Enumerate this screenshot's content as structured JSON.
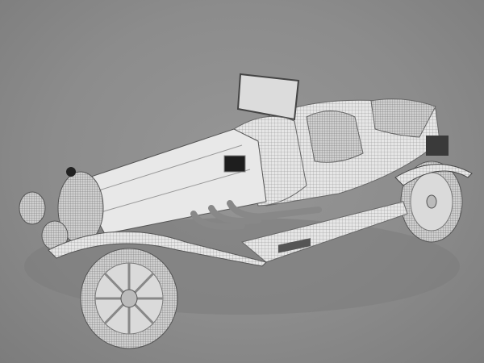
{
  "scene": {
    "subject": "wireframe-vintage-car-render",
    "colors": {
      "background": "#8c8c8c",
      "body": "#e4e4e4",
      "wire": "#6a6a6a",
      "shadow": "#7a7a7a",
      "dark": "#2a2a2a"
    }
  }
}
